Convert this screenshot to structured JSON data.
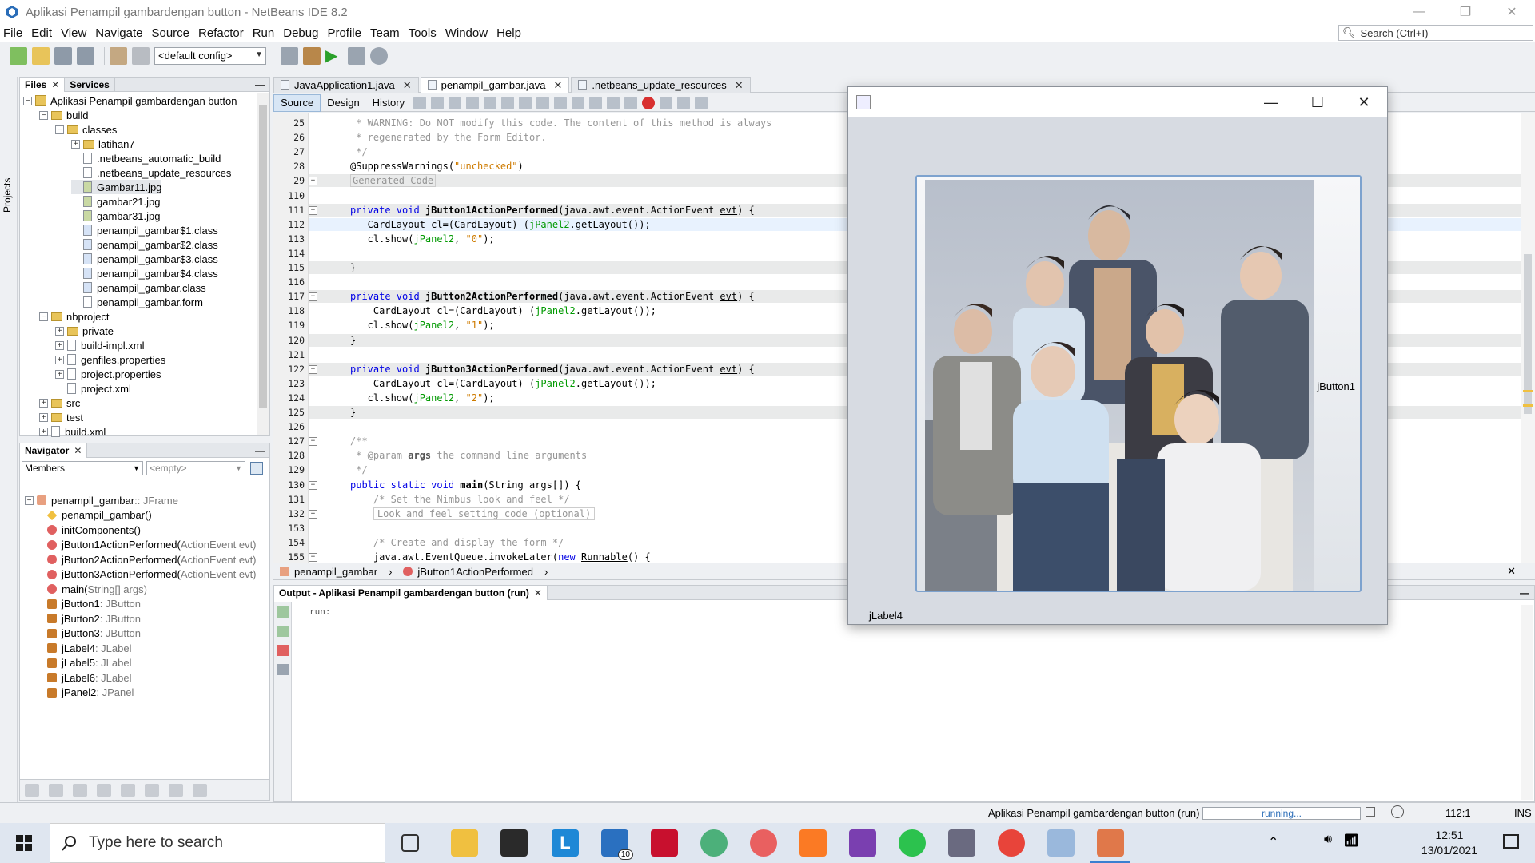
{
  "window": {
    "title": "Aplikasi Penampil gambardengan button - NetBeans IDE 8.2"
  },
  "menu": [
    "File",
    "Edit",
    "View",
    "Navigate",
    "Source",
    "Refactor",
    "Run",
    "Debug",
    "Profile",
    "Team",
    "Tools",
    "Window",
    "Help"
  ],
  "search": {
    "placeholder": "Search (Ctrl+I)"
  },
  "toolbar": {
    "config": "<default config>"
  },
  "left_strip": {
    "label": "Projects"
  },
  "files_panel": {
    "tabs": [
      "Files",
      "Services"
    ],
    "tree": [
      {
        "label": "Aplikasi Penampil gambardengan button",
        "level": 0,
        "type": "project",
        "toggle": "−"
      },
      {
        "label": "build",
        "level": 1,
        "type": "folder",
        "toggle": "−"
      },
      {
        "label": "classes",
        "level": 2,
        "type": "folder",
        "toggle": "−"
      },
      {
        "label": "latihan7",
        "level": 3,
        "type": "folder",
        "toggle": "+"
      },
      {
        "label": ".netbeans_automatic_build",
        "level": 3,
        "type": "file"
      },
      {
        "label": ".netbeans_update_resources",
        "level": 3,
        "type": "file"
      },
      {
        "label": "Gambar11.jpg",
        "level": 3,
        "type": "img",
        "selected": true
      },
      {
        "label": "gambar21.jpg",
        "level": 3,
        "type": "img"
      },
      {
        "label": "gambar31.jpg",
        "level": 3,
        "type": "img"
      },
      {
        "label": "penampil_gambar$1.class",
        "level": 3,
        "type": "cls"
      },
      {
        "label": "penampil_gambar$2.class",
        "level": 3,
        "type": "cls"
      },
      {
        "label": "penampil_gambar$3.class",
        "level": 3,
        "type": "cls"
      },
      {
        "label": "penampil_gambar$4.class",
        "level": 3,
        "type": "cls"
      },
      {
        "label": "penampil_gambar.class",
        "level": 3,
        "type": "cls"
      },
      {
        "label": "penampil_gambar.form",
        "level": 3,
        "type": "file"
      },
      {
        "label": "nbproject",
        "level": 1,
        "type": "folder",
        "toggle": "−"
      },
      {
        "label": "private",
        "level": 2,
        "type": "folder",
        "toggle": "+"
      },
      {
        "label": "build-impl.xml",
        "level": 2,
        "type": "file",
        "toggle": "+"
      },
      {
        "label": "genfiles.properties",
        "level": 2,
        "type": "file",
        "toggle": "+"
      },
      {
        "label": "project.properties",
        "level": 2,
        "type": "file",
        "toggle": "+"
      },
      {
        "label": "project.xml",
        "level": 2,
        "type": "file"
      },
      {
        "label": "src",
        "level": 1,
        "type": "folder",
        "toggle": "+"
      },
      {
        "label": "test",
        "level": 1,
        "type": "folder",
        "toggle": "+"
      },
      {
        "label": "build.xml",
        "level": 1,
        "type": "file",
        "toggle": "+"
      }
    ]
  },
  "navigator": {
    "title": "Navigator",
    "filter": "Members",
    "filter2": "<empty>",
    "items": [
      {
        "name": "penampil_gambar",
        "type": " :: JFrame",
        "icon": "cls",
        "level": 0
      },
      {
        "name": "penampil_gambar()",
        "type": "",
        "icon": "ctor",
        "level": 1
      },
      {
        "name": "initComponents()",
        "type": "",
        "icon": "meth",
        "level": 1
      },
      {
        "name": "jButton1ActionPerformed(",
        "type": "ActionEvent evt)",
        "icon": "meth",
        "level": 1
      },
      {
        "name": "jButton2ActionPerformed(",
        "type": "ActionEvent evt)",
        "icon": "meth",
        "level": 1
      },
      {
        "name": "jButton3ActionPerformed(",
        "type": "ActionEvent evt)",
        "icon": "meth",
        "level": 1
      },
      {
        "name": "main(",
        "type": "String[] args)",
        "icon": "meth",
        "level": 1
      },
      {
        "name": "jButton1",
        "type": " : JButton",
        "icon": "fld",
        "level": 1
      },
      {
        "name": "jButton2",
        "type": " : JButton",
        "icon": "fld",
        "level": 1
      },
      {
        "name": "jButton3",
        "type": " : JButton",
        "icon": "fld",
        "level": 1
      },
      {
        "name": "jLabel4",
        "type": " : JLabel",
        "icon": "fld",
        "level": 1
      },
      {
        "name": "jLabel5",
        "type": " : JLabel",
        "icon": "fld",
        "level": 1
      },
      {
        "name": "jLabel6",
        "type": " : JLabel",
        "icon": "fld",
        "level": 1
      },
      {
        "name": "jPanel2",
        "type": " : JPanel",
        "icon": "fld",
        "level": 1
      }
    ]
  },
  "editor": {
    "tabs": [
      {
        "label": "JavaApplication1.java",
        "active": false
      },
      {
        "label": "penampil_gambar.java",
        "active": true
      },
      {
        "label": ".netbeans_update_resources",
        "active": false
      }
    ],
    "views": [
      "Source",
      "Design",
      "History"
    ],
    "lines": [
      {
        "n": "25",
        "html": "<span class='cm'> * WARNING: Do NOT modify this code. The content of this method is always</span>"
      },
      {
        "n": "26",
        "html": "<span class='cm'> * regenerated by the Form Editor.</span>"
      },
      {
        "n": "27",
        "html": "<span class='cm'> */</span>"
      },
      {
        "n": "28",
        "html": "@SuppressWarnings(<span class='str'>\"unchecked\"</span>)"
      },
      {
        "n": "29",
        "html": "<span class='cm' style='border:1px solid #ccc;padding:0 2px'>Generated Code</span>",
        "fold": "+",
        "hl": true
      },
      {
        "n": "110",
        "html": ""
      },
      {
        "n": "111",
        "html": "<span class='kw'>private void</span> <span class='meth'>jButton1ActionPerformed</span>(java.awt.event.ActionEvent <u>evt</u>) {",
        "fold": "−",
        "hl": true
      },
      {
        "n": "112",
        "html": "   CardLayout cl=(CardLayout) (<span class='gn'>jPanel2</span>.getLayout());",
        "cur": true
      },
      {
        "n": "113",
        "html": "   cl.show(<span class='gn'>jPanel2</span>, <span class='str'>\"0\"</span>);"
      },
      {
        "n": "114",
        "html": ""
      },
      {
        "n": "115",
        "html": "}",
        "hl": true
      },
      {
        "n": "116",
        "html": ""
      },
      {
        "n": "117",
        "html": "<span class='kw'>private void</span> <span class='meth'>jButton2ActionPerformed</span>(java.awt.event.ActionEvent <u>evt</u>) {",
        "fold": "−",
        "hl": true
      },
      {
        "n": "118",
        "html": "    CardLayout cl=(CardLayout) (<span class='gn'>jPanel2</span>.getLayout());"
      },
      {
        "n": "119",
        "html": "   cl.show(<span class='gn'>jPanel2</span>, <span class='str'>\"1\"</span>);"
      },
      {
        "n": "120",
        "html": "}",
        "hl": true
      },
      {
        "n": "121",
        "html": ""
      },
      {
        "n": "122",
        "html": "<span class='kw'>private void</span> <span class='meth'>jButton3ActionPerformed</span>(java.awt.event.ActionEvent <u>evt</u>) {",
        "fold": "−",
        "hl": true
      },
      {
        "n": "123",
        "html": "    CardLayout cl=(CardLayout) (<span class='gn'>jPanel2</span>.getLayout());"
      },
      {
        "n": "124",
        "html": "   cl.show(<span class='gn'>jPanel2</span>, <span class='str'>\"2\"</span>);"
      },
      {
        "n": "125",
        "html": "}",
        "hl": true
      },
      {
        "n": "126",
        "html": ""
      },
      {
        "n": "127",
        "html": "<span class='cm'>/**</span>",
        "fold": "−"
      },
      {
        "n": "128",
        "html": "<span class='cm'> * @param <b style='color:#555'>args</b> the command line arguments</span>"
      },
      {
        "n": "129",
        "html": "<span class='cm'> */</span>"
      },
      {
        "n": "130",
        "html": "<span class='kw'>public static void</span> <span class='meth'>main</span>(String args[]) {",
        "fold": "−"
      },
      {
        "n": "131",
        "html": "    <span class='cm'>/* Set the Nimbus look and feel */</span>"
      },
      {
        "n": "132",
        "html": "    <span class='cm' style='border:1px solid #ccc;padding:0 4px'>Look and feel setting code (optional)</span>",
        "fold": "+"
      },
      {
        "n": "153",
        "html": ""
      },
      {
        "n": "154",
        "html": "    <span class='cm'>/* Create and display the form */</span>"
      },
      {
        "n": "155",
        "html": "    java.awt.EventQueue.invokeLater(<span class='kw'>new</span> <u>Runnable</u>() {",
        "fold": "−"
      }
    ]
  },
  "breadcrumbs": [
    "penampil_gambar",
    "jButton1ActionPerformed"
  ],
  "output": {
    "title": "Output - Aplikasi Penampil gambardengan button (run)",
    "text": "run:"
  },
  "statusbar": {
    "task": "Aplikasi Penampil gambardengan button (run)",
    "progress_text": "running...",
    "position": "112:1",
    "mode": "INS"
  },
  "jframe": {
    "button_label": "jButton1",
    "label": "jLabel4"
  },
  "taskbar": {
    "search_placeholder": "Type here to search",
    "time": "12:51",
    "date": "13/01/2021",
    "mail_badge": "10"
  }
}
